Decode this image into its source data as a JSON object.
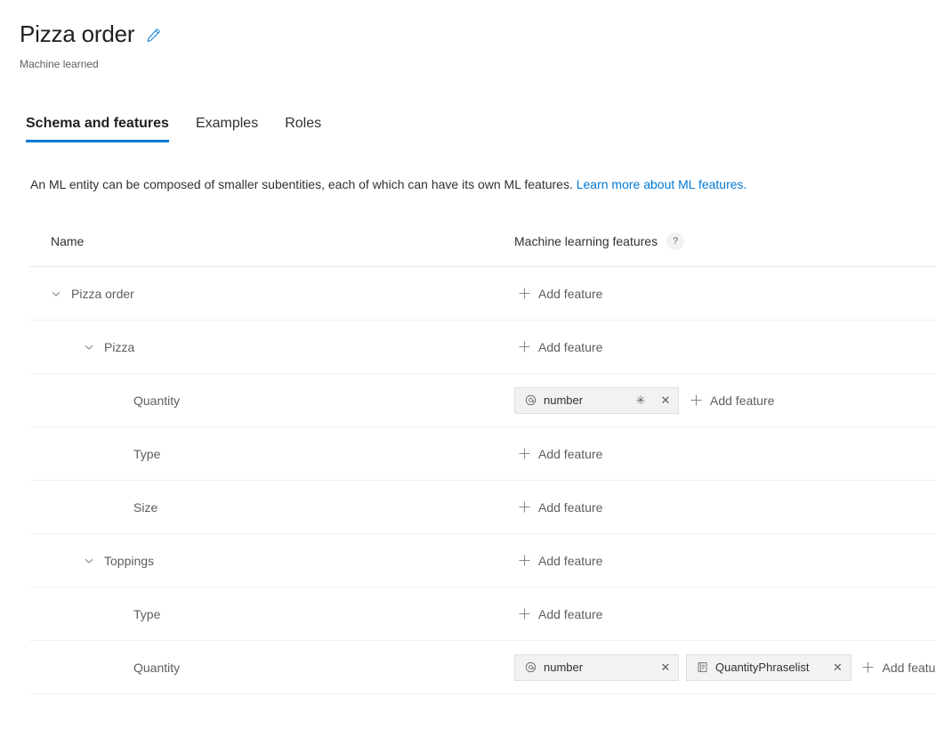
{
  "header": {
    "title": "Pizza order",
    "edit_icon": "pencil-icon",
    "subtitle": "Machine learned"
  },
  "tabs": [
    {
      "label": "Schema and features",
      "active": true
    },
    {
      "label": "Examples",
      "active": false
    },
    {
      "label": "Roles",
      "active": false
    }
  ],
  "description": {
    "text": "An ML entity can be composed of smaller subentities, each of which can have its own ML features.",
    "link_text": "Learn more about ML features."
  },
  "table": {
    "columns": {
      "name": "Name",
      "features": "Machine learning features",
      "help_icon": "?"
    },
    "add_feature_label": "Add feature",
    "rows": [
      {
        "name": "Pizza order",
        "level": 0,
        "expandable": true,
        "chips": []
      },
      {
        "name": "Pizza",
        "level": 1,
        "expandable": true,
        "chips": []
      },
      {
        "name": "Quantity",
        "level": 2,
        "expandable": false,
        "chips": [
          {
            "icon": "at-sign-icon",
            "label": "number",
            "required": "✳",
            "close": "✕"
          }
        ]
      },
      {
        "name": "Type",
        "level": 2,
        "expandable": false,
        "chips": []
      },
      {
        "name": "Size",
        "level": 2,
        "expandable": false,
        "chips": []
      },
      {
        "name": "Toppings",
        "level": 1,
        "expandable": true,
        "chips": []
      },
      {
        "name": "Type",
        "level": 2,
        "expandable": false,
        "chips": []
      },
      {
        "name": "Quantity",
        "level": 2,
        "expandable": false,
        "chips": [
          {
            "icon": "at-sign-icon",
            "label": "number",
            "close": "✕"
          },
          {
            "icon": "phraselist-icon",
            "label": "QuantityPhraselist",
            "close": "✕"
          }
        ]
      }
    ]
  },
  "colors": {
    "accent": "#0078d4",
    "text_primary": "#323130",
    "text_secondary": "#605e5c",
    "chip_bg": "#f3f2f1",
    "divider": "#f3f2f1"
  }
}
